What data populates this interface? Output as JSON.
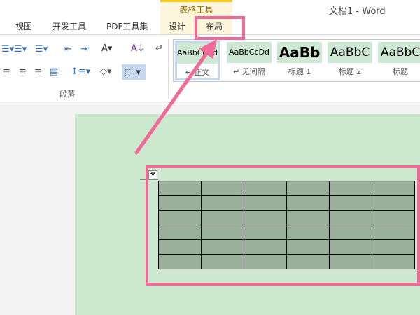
{
  "window": {
    "title": "文档1 - Word"
  },
  "tabs": [
    "视图",
    "开发工具",
    "PDF工具集",
    "设计",
    "布局"
  ],
  "context_tab_group": "表格工具",
  "paragraph_group": {
    "label": "段落"
  },
  "styles": [
    {
      "preview": "AaBbCcDd",
      "name": "↵ 正文"
    },
    {
      "preview": "AaBbCcDd",
      "name": "↵ 无间隔"
    },
    {
      "preview": "AaBb",
      "name": "标题 1"
    },
    {
      "preview": "AaBbC",
      "name": "标题 2"
    },
    {
      "preview": "AaBbC",
      "name": "标题"
    }
  ],
  "table": {
    "rows": 6,
    "cols": 6
  },
  "colors": {
    "highlight": "#f06a98",
    "page": "#cce8cf",
    "cell": "#9bb09a"
  }
}
